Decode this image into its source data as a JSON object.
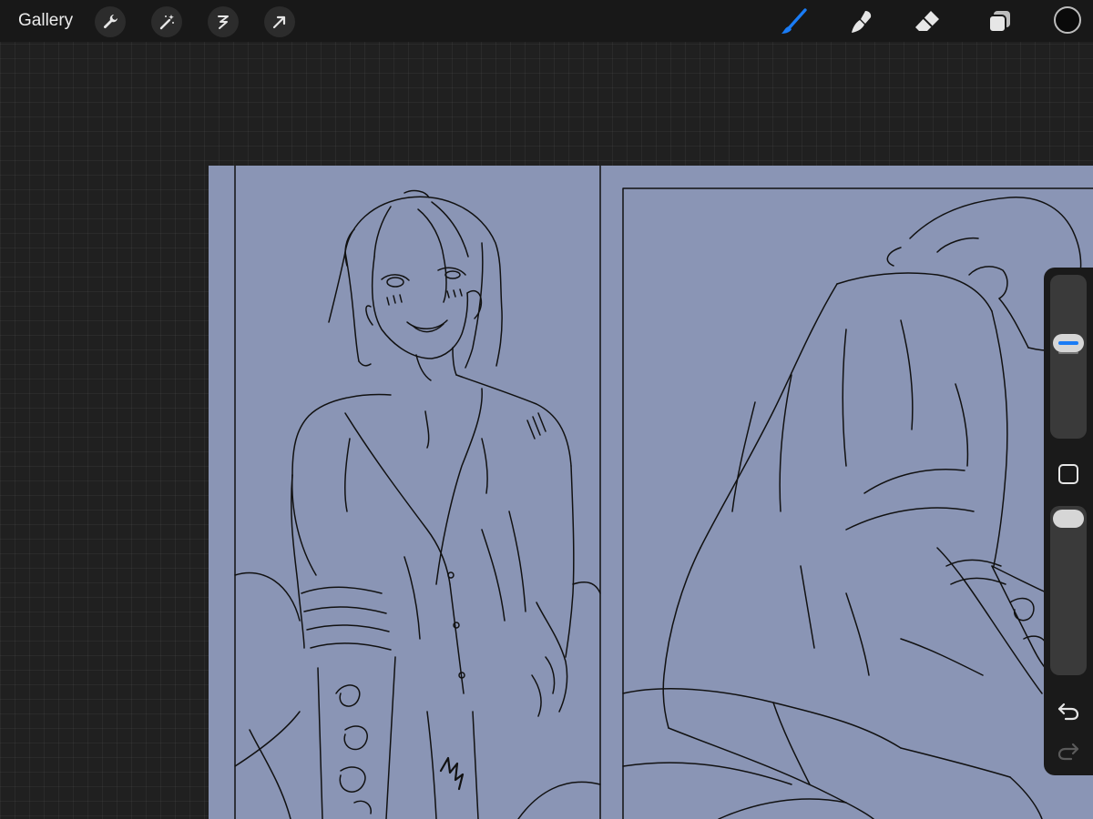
{
  "toolbar": {
    "gallery_label": "Gallery",
    "left_tools": [
      "wrench-icon",
      "magic-wand-icon",
      "selection-icon",
      "transform-arrow-icon"
    ],
    "right_tools": [
      "brush-icon",
      "smudge-icon",
      "eraser-icon",
      "layers-icon"
    ],
    "active_tool": "brush-icon",
    "active_color": "#0a0a0a",
    "accent": "#1a7cf5"
  },
  "canvas": {
    "background_color": "#8a95b5",
    "line_color": "#111111"
  },
  "side_panel": {
    "brush_size_fraction": 0.6,
    "opacity_fraction": 1.0,
    "buttons": [
      "modify-square-icon",
      "undo-icon",
      "redo-icon"
    ]
  }
}
